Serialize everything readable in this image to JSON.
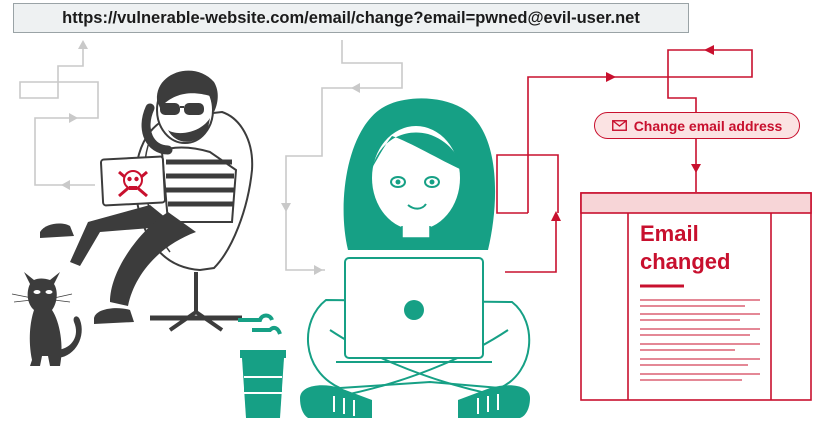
{
  "url_bar": {
    "text": "https://vulnerable-website.com/email/change?email=pwned@evil-user.net"
  },
  "request_pill": {
    "label": "Change email address",
    "icon": "envelope-icon"
  },
  "result_page": {
    "title_line1": "Email",
    "title_line2": "changed"
  },
  "colors": {
    "accent": "#c8102e",
    "victim": "#16a085",
    "attacker": "#3c3c3c",
    "grey_flow": "#c6c6c6"
  }
}
